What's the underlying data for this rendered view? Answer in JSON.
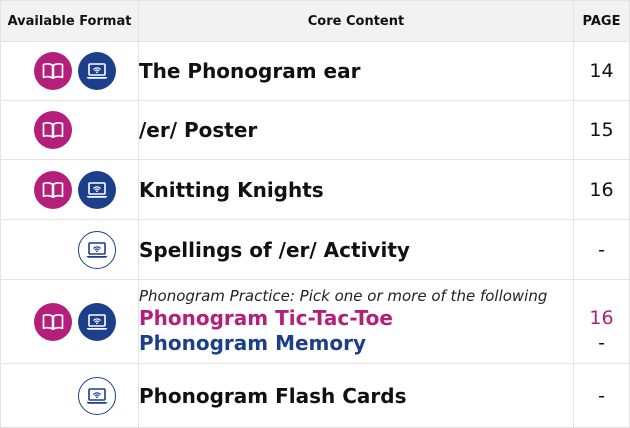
{
  "header": {
    "formats": "Available Format",
    "content": "Core Content",
    "page": "PAGE"
  },
  "rows": [
    {
      "title": "The Phonogram ear",
      "page": "14",
      "formats": [
        "book-icon",
        "web-icon"
      ]
    },
    {
      "title": "/er/ Poster",
      "page": "15",
      "formats": [
        "book-icon"
      ]
    },
    {
      "title": "Knitting Knights",
      "page": "16",
      "formats": [
        "book-icon",
        "web-icon"
      ]
    },
    {
      "title": "Spellings of /er/ Activity",
      "page": "-",
      "formats": [
        "web-icon"
      ]
    },
    {
      "note": "Phonogram Practice: Pick one or more of the following",
      "items": [
        {
          "title": "Phonogram Tic-Tac-Toe",
          "page": "16"
        },
        {
          "title": "Phonogram Memory",
          "page": "-"
        }
      ],
      "formats": [
        "book-icon",
        "web-icon"
      ]
    },
    {
      "title": "Phonogram Flash Cards",
      "page": "-",
      "formats": [
        "web-icon"
      ]
    }
  ],
  "colors": {
    "book": "#b41f7b",
    "web": "#1c3f8c",
    "header_bg": "#f2f2f2"
  }
}
